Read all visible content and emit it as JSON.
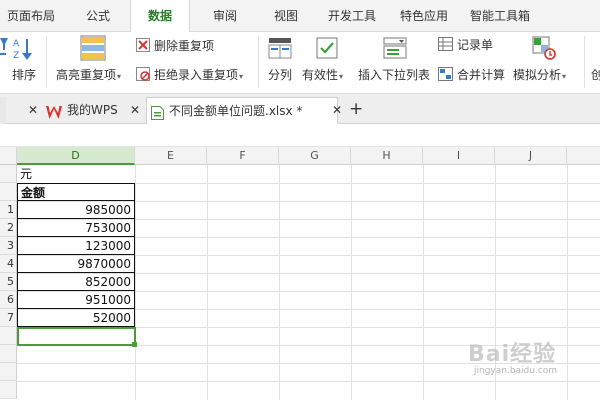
{
  "menu": {
    "tabs": [
      {
        "label": "页面布局"
      },
      {
        "label": "公式"
      },
      {
        "label": "数据",
        "active": true
      },
      {
        "label": "审阅"
      },
      {
        "label": "视图"
      },
      {
        "label": "开发工具"
      },
      {
        "label": "特色应用"
      },
      {
        "label": "智能工具箱"
      }
    ]
  },
  "ribbon": {
    "sort_label": "排序",
    "highlight_dup_label": "高亮重复项",
    "delete_dup_label": "删除重复项",
    "reject_dup_label": "拒绝录入重复项",
    "split_label": "分列",
    "validity_label": "有效性",
    "insert_dropdown_label": "插入下拉列表",
    "record_label": "记录单",
    "merge_calc_label": "合并计算",
    "simulate_label": "模拟分析",
    "truncated_label": "创"
  },
  "doc_tabs": {
    "tabs": [
      {
        "label": "我的WPS"
      },
      {
        "label": "不同金额单位问题.xlsx *",
        "active": true
      }
    ],
    "new_tab": "+"
  },
  "sheet": {
    "columns": [
      "D",
      "E",
      "F",
      "G",
      "H",
      "I",
      "J"
    ],
    "unit_text": "元",
    "header_text": "金额",
    "rows": [
      {
        "num": "1",
        "value": "985000"
      },
      {
        "num": "2",
        "value": "753000"
      },
      {
        "num": "3",
        "value": "123000"
      },
      {
        "num": "4",
        "value": "9870000"
      },
      {
        "num": "5",
        "value": "852000"
      },
      {
        "num": "6",
        "value": "951000"
      },
      {
        "num": "7",
        "value": "52000"
      }
    ]
  },
  "watermark": {
    "text": "Bai经验",
    "sub": "jingyan.baidu.com"
  },
  "colors": {
    "accent_green": "#4e9a3b",
    "wps_red": "#d9322f"
  }
}
